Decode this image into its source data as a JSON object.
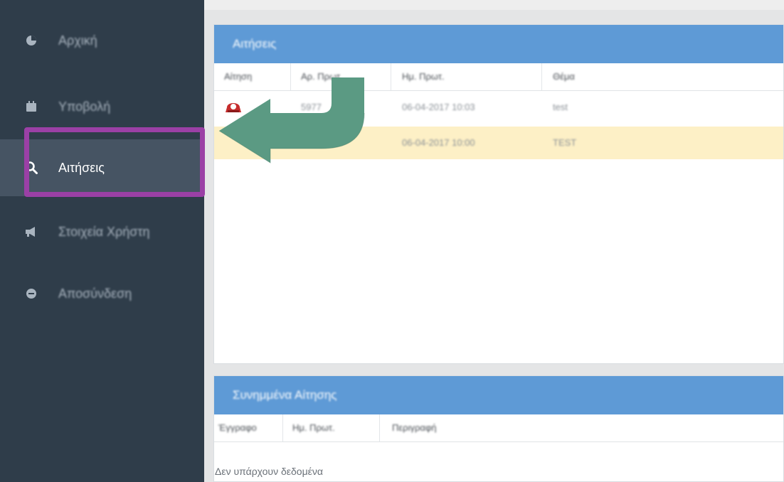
{
  "sidebar": {
    "items": [
      {
        "label": "Αρχική",
        "icon": "pie-chart-icon"
      },
      {
        "label": "Υποβολή",
        "icon": "calendar-icon"
      },
      {
        "label": "Αιτήσεις",
        "icon": "search-icon",
        "active": true
      },
      {
        "label": "Στοιχεία Χρήστη",
        "icon": "megaphone-icon"
      },
      {
        "label": "Αποσύνδεση",
        "icon": "logout-icon"
      }
    ]
  },
  "requests_panel": {
    "title": "Αιτήσεις",
    "columns": [
      "Αίτηση",
      "Αρ. Πρωτ.",
      "Ημ. Πρωτ.",
      "Θέμα"
    ],
    "rows": [
      {
        "number": "5977",
        "date": "06-04-2017 10:03",
        "subject": "test",
        "icon": "pdf-icon"
      },
      {
        "number": "",
        "date": "06-04-2017 10:00",
        "subject": "TEST",
        "selected": true
      }
    ]
  },
  "attachments_panel": {
    "title": "Συνημμένα Αίτησης",
    "columns": [
      "Έγγραφο",
      "Ημ. Πρωτ.",
      "Περιγραφή"
    ],
    "empty_text": "Δεν υπάρχουν δεδομένα"
  },
  "colors": {
    "sidebar_bg": "#2f3d4a",
    "sidebar_active_bg": "#465463",
    "panel_header": "#5e9ad6",
    "highlight_border": "#9b40a6",
    "selected_row": "#fdf0c6",
    "arrow": "#5b9a83"
  }
}
